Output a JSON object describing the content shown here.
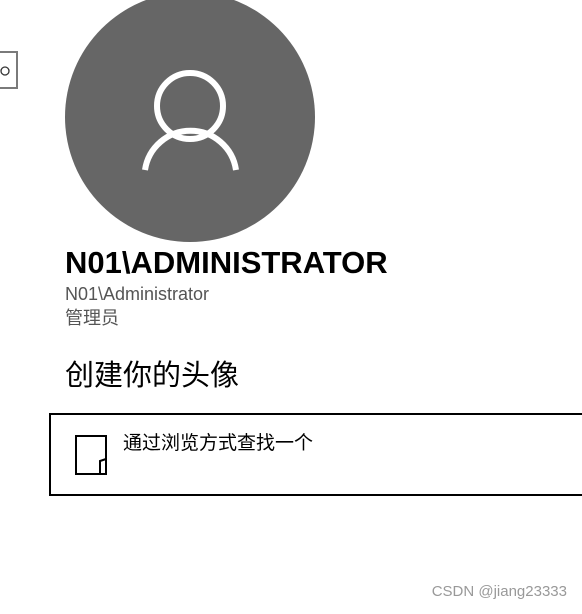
{
  "account": {
    "display_name": "N01\\ADMINISTRATOR",
    "account_name": "N01\\Administrator",
    "role": "管理员"
  },
  "avatar": {
    "icon": "person-icon",
    "background_color": "#666666"
  },
  "create_avatar": {
    "heading": "创建你的头像",
    "browse_option": {
      "label": "通过浏览方式查找一个",
      "icon": "file-icon"
    }
  },
  "watermark": "CSDN @jiang23333"
}
